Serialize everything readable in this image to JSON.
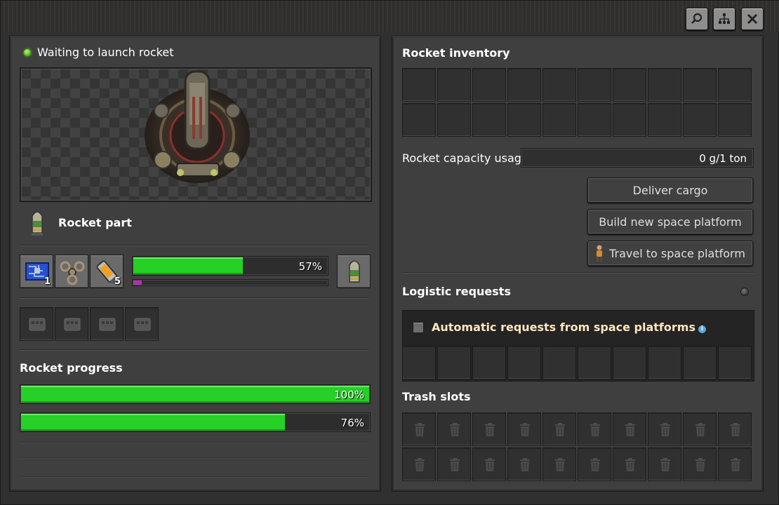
{
  "left": {
    "status_text": "Waiting to launch rocket",
    "recipe_label": "Rocket part",
    "ingredients": [
      {
        "icon": "processing-unit-icon",
        "count": "1"
      },
      {
        "icon": "low-density-structure-icon",
        "count": ""
      },
      {
        "icon": "rocket-fuel-icon",
        "count": "5"
      }
    ],
    "crafting_progress": "57%",
    "crafting_fraction": 0.57,
    "bonus_fraction": 0.05,
    "progress_heading": "Rocket progress",
    "progress_bars": [
      {
        "percent": "100%",
        "fraction": 1.0
      },
      {
        "percent": "76%",
        "fraction": 0.76
      }
    ]
  },
  "right": {
    "inventory_heading": "Rocket inventory",
    "capacity_label": "Rocket capacity usage",
    "capacity_value": "0 g/1 ton",
    "buttons": {
      "deliver": "Deliver cargo",
      "build": "Build new space platform",
      "travel": "Travel to space platform"
    },
    "logistic_heading": "Logistic requests",
    "auto_requests_label": "Automatic requests from space platforms",
    "trash_heading": "Trash slots"
  },
  "colors": {
    "progress_green": "#26d026",
    "bonus_purple": "#b32db3",
    "orange_text": "#ffe6c0"
  }
}
